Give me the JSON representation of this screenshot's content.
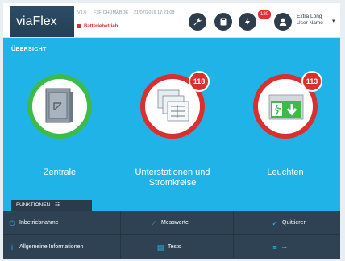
{
  "header": {
    "brand": "viaFlex",
    "meta": [
      "V1.0",
      "F3F-CHUMABDE",
      "21/07/2016 17:21:08"
    ],
    "battery_status": "Batteriebetrieb",
    "notification_count": "120",
    "user_name": "Extra Long User Name"
  },
  "overview": {
    "title": "ÜBERSICHT",
    "tiles": [
      {
        "label": "Zentrale",
        "status": "ok"
      },
      {
        "label": "Unterstationen und Stromkreise",
        "status": "error",
        "count": "118"
      },
      {
        "label": "Leuchten",
        "status": "error",
        "count": "113"
      }
    ]
  },
  "functions": {
    "title": "FUNKTIONEN",
    "items": [
      {
        "label": "Inbetriebnahme",
        "icon": "power-icon"
      },
      {
        "label": "Messwerte",
        "icon": "trend-icon"
      },
      {
        "label": "Quittieren",
        "icon": "check-icon"
      },
      {
        "label": "Allgemeine Informationen",
        "icon": "info-icon"
      },
      {
        "label": "Tests",
        "icon": "clipboard-icon"
      },
      {
        "label": "...",
        "icon": "menu-icon"
      }
    ]
  },
  "colors": {
    "accent": "#1fb3e8",
    "ok": "#3dbb4a",
    "error": "#d9302f",
    "dark": "#2f4253"
  }
}
